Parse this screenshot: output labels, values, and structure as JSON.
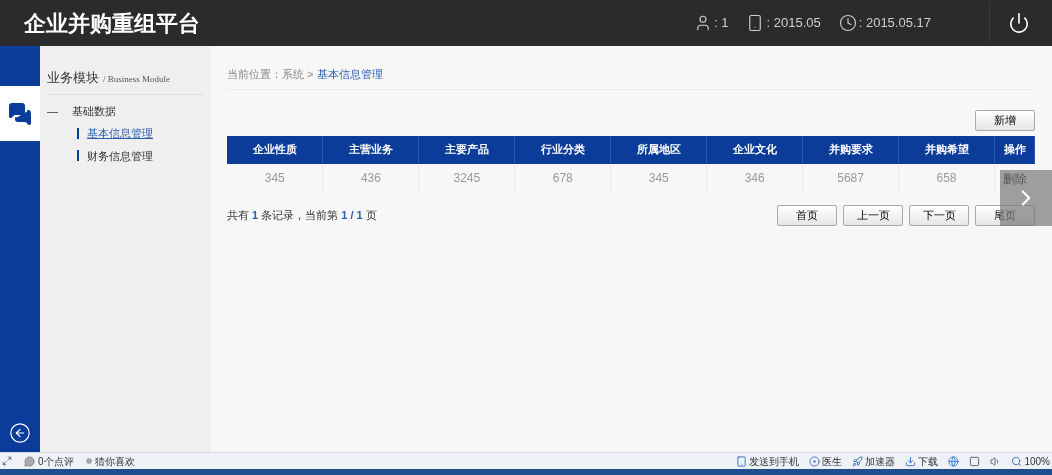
{
  "header": {
    "title": "企业并购重组平台",
    "stats": [
      {
        "kind": "user",
        "text": ": 1"
      },
      {
        "kind": "phone",
        "text": ": 2015.05"
      },
      {
        "kind": "clock",
        "text": ": 2015.05.17"
      }
    ]
  },
  "sidebar": {
    "title": "业务模块",
    "subtitle": "/ Business Module",
    "groups": [
      {
        "toggle": "—",
        "label": "基础数据",
        "expanded": true,
        "children": [
          {
            "label": "基本信息管理",
            "selected": true
          },
          {
            "label": "财务信息管理",
            "selected": false
          }
        ]
      }
    ]
  },
  "breadcrumb": {
    "prefix": "当前位置：系统 >",
    "current": "基本信息管理"
  },
  "add_button": "新增",
  "table": {
    "columns": [
      "企业性质",
      "主营业务",
      "主要产品",
      "行业分类",
      "所属地区",
      "企业文化",
      "并购要求",
      "并购希望",
      "操作"
    ],
    "rows": [
      {
        "cells": [
          "345",
          "436",
          "3245",
          "678",
          "345",
          "346",
          "5687",
          "658"
        ],
        "action": "删除"
      }
    ]
  },
  "pagination": {
    "summary": "共有 **1** 条记录，当前第 **1 / 1** 页",
    "buttons": [
      "首页",
      "上一页",
      "下一页",
      "尾页"
    ]
  },
  "status_bar": {
    "left": [
      {
        "kind": "comment",
        "text": "0个点评"
      },
      {
        "kind": "dot",
        "text": "猜你喜欢"
      }
    ],
    "right": [
      {
        "kind": "phone",
        "text": "发送到手机"
      },
      {
        "kind": "doctor",
        "text": "医生"
      },
      {
        "kind": "speed",
        "text": "加速器"
      },
      {
        "kind": "download",
        "text": "下载"
      },
      {
        "kind": "zoom",
        "text": "100%"
      }
    ]
  }
}
